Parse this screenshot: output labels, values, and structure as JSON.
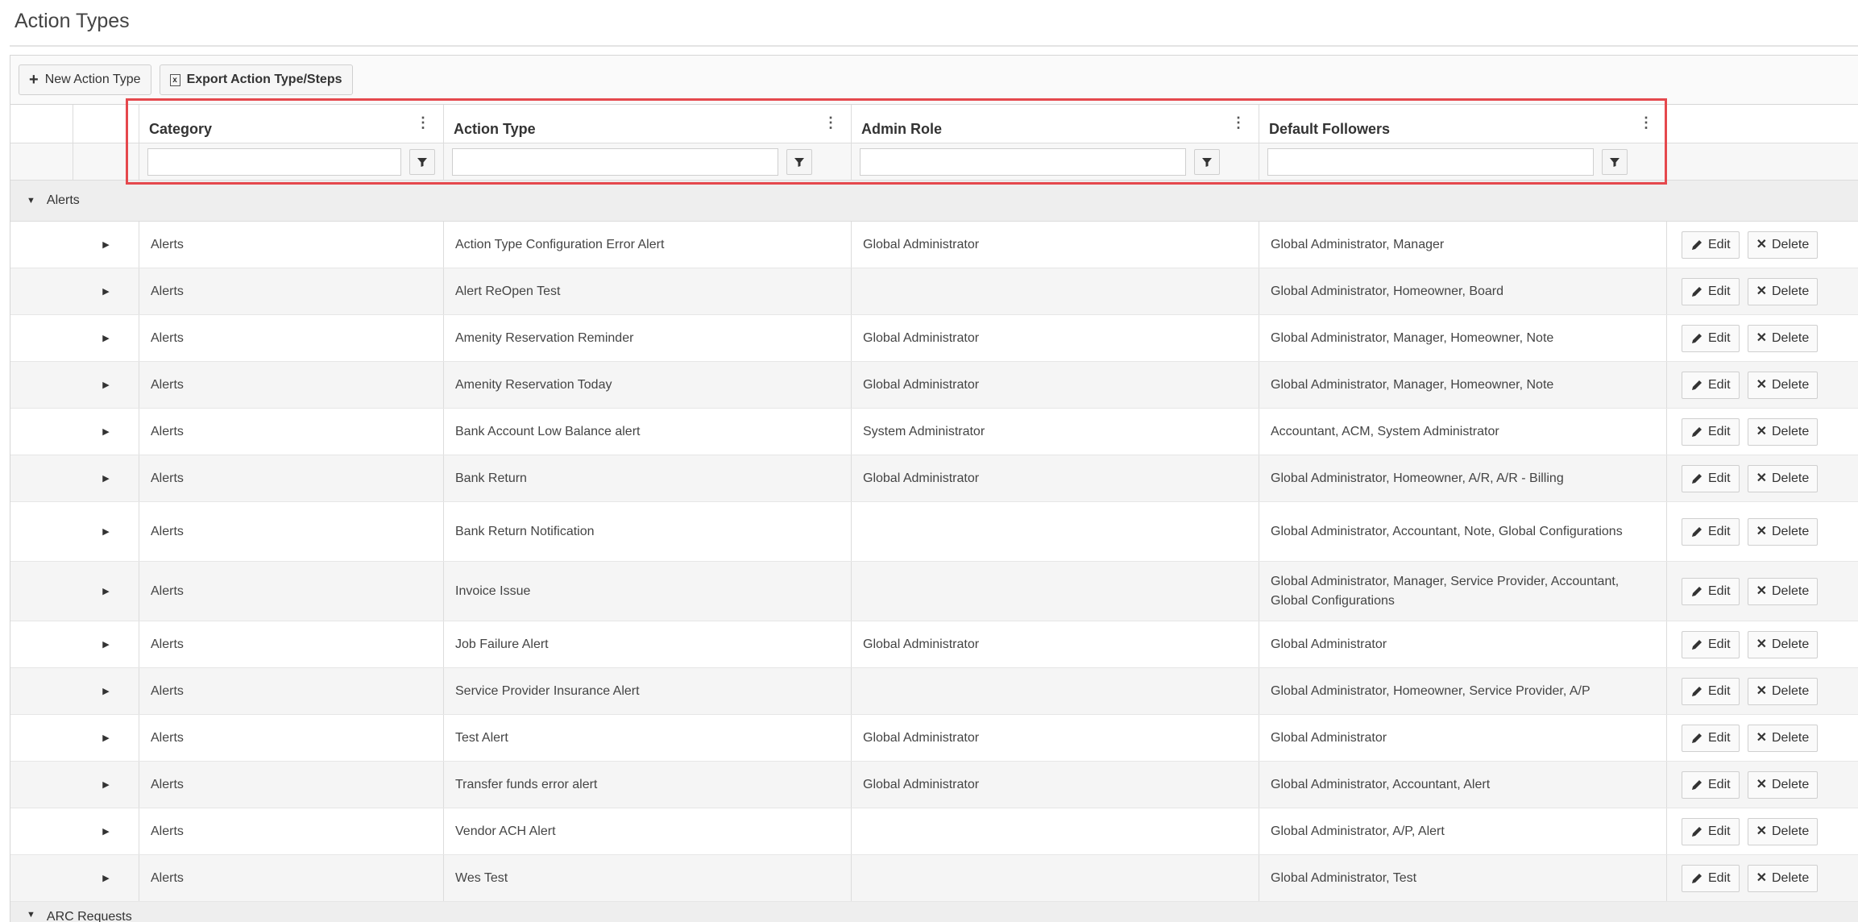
{
  "page": {
    "title": "Action Types"
  },
  "toolbar": {
    "new_label": "New Action Type",
    "export_label": "Export Action Type/Steps"
  },
  "columns": {
    "category": "Category",
    "action_type": "Action Type",
    "admin_role": "Admin Role",
    "default_followers": "Default Followers"
  },
  "icons": {
    "column_menu": "kebab-icon",
    "filter": "filter-icon",
    "expand": "caret-right-icon",
    "collapse": "caret-down-icon",
    "edit": "pencil-icon",
    "delete": "x-icon",
    "export": "excel-icon"
  },
  "groups": [
    {
      "label": "Alerts"
    },
    {
      "label": "ARC Requests"
    }
  ],
  "buttons": {
    "edit": "Edit",
    "delete": "Delete"
  },
  "rows": [
    {
      "category": "Alerts",
      "action_type": "Action Type Configuration Error Alert",
      "admin_role": "Global Administrator",
      "followers": "Global Administrator, Manager"
    },
    {
      "category": "Alerts",
      "action_type": "Alert ReOpen Test",
      "admin_role": "",
      "followers": "Global Administrator, Homeowner, Board"
    },
    {
      "category": "Alerts",
      "action_type": "Amenity Reservation Reminder",
      "admin_role": "Global Administrator",
      "followers": "Global Administrator, Manager, Homeowner, Note"
    },
    {
      "category": "Alerts",
      "action_type": "Amenity Reservation Today",
      "admin_role": "Global Administrator",
      "followers": "Global Administrator, Manager, Homeowner, Note"
    },
    {
      "category": "Alerts",
      "action_type": "Bank Account Low Balance alert",
      "admin_role": "System Administrator",
      "followers": "Accountant, ACM, System Administrator"
    },
    {
      "category": "Alerts",
      "action_type": "Bank Return",
      "admin_role": "Global Administrator",
      "followers": "Global Administrator, Homeowner, A/R, A/R - Billing"
    },
    {
      "category": "Alerts",
      "action_type": "Bank Return Notification",
      "admin_role": "",
      "followers": "Global Administrator, Accountant, Note, Global Configurations"
    },
    {
      "category": "Alerts",
      "action_type": "Invoice Issue",
      "admin_role": "",
      "followers": "Global Administrator, Manager, Service Provider, Accountant, Global Configurations"
    },
    {
      "category": "Alerts",
      "action_type": "Job Failure Alert",
      "admin_role": "Global Administrator",
      "followers": "Global Administrator"
    },
    {
      "category": "Alerts",
      "action_type": "Service Provider Insurance Alert",
      "admin_role": "",
      "followers": "Global Administrator, Homeowner, Service Provider, A/P"
    },
    {
      "category": "Alerts",
      "action_type": "Test Alert",
      "admin_role": "Global Administrator",
      "followers": "Global Administrator"
    },
    {
      "category": "Alerts",
      "action_type": "Transfer funds error alert",
      "admin_role": "Global Administrator",
      "followers": "Global Administrator, Accountant, Alert"
    },
    {
      "category": "Alerts",
      "action_type": "Vendor ACH Alert",
      "admin_role": "",
      "followers": "Global Administrator, A/P, Alert"
    },
    {
      "category": "Alerts",
      "action_type": "Wes Test",
      "admin_role": "",
      "followers": "Global Administrator, Test"
    }
  ],
  "colors": {
    "highlight": "#e5484d",
    "row_alt": "#f5f5f5",
    "group_bg": "#eeeeee"
  }
}
